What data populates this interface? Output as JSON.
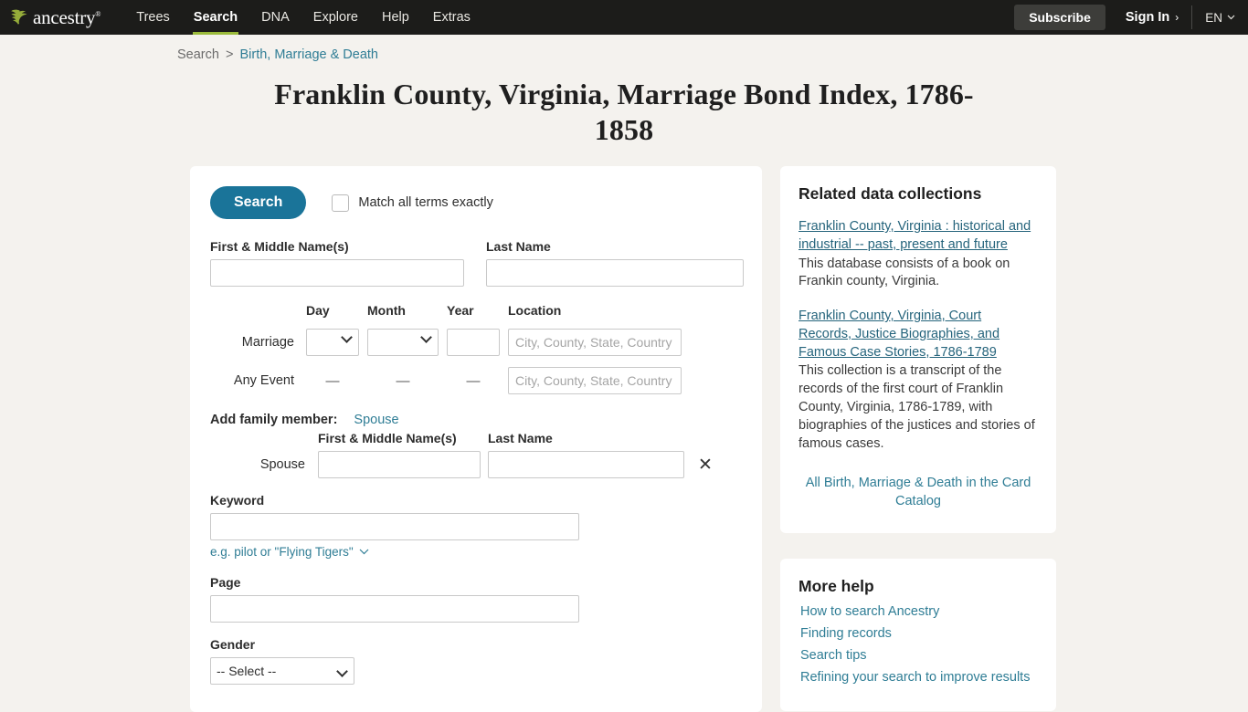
{
  "header": {
    "logo_text": "ancestry",
    "logo_tm": "®",
    "nav": [
      {
        "label": "Trees",
        "active": false
      },
      {
        "label": "Search",
        "active": true
      },
      {
        "label": "DNA",
        "active": false
      },
      {
        "label": "Explore",
        "active": false
      },
      {
        "label": "Help",
        "active": false
      },
      {
        "label": "Extras",
        "active": false
      }
    ],
    "subscribe_label": "Subscribe",
    "signin_label": "Sign In",
    "signin_chevron": "›",
    "language": "EN",
    "language_caret": "⌵"
  },
  "breadcrumb": {
    "root": "Search",
    "separator": ">",
    "current": "Birth, Marriage & Death"
  },
  "page_title": "Franklin County, Virginia, Marriage Bond Index, 1786-1858",
  "form": {
    "search_button": "Search",
    "match_exactly_label": "Match all terms exactly",
    "first_name_label": "First & Middle Name(s)",
    "last_name_label": "Last Name",
    "first_name_value": "",
    "last_name_value": "",
    "event_headers": {
      "day": "Day",
      "month": "Month",
      "year": "Year",
      "location": "Location"
    },
    "marriage_row_label": "Marriage",
    "any_event_row_label": "Any Event",
    "day_value": "",
    "month_value": "",
    "year_value": "",
    "location_placeholder": "City, County, State, Country",
    "marriage_location_value": "",
    "any_event_location_value": "",
    "dash": "—",
    "add_family_label": "Add family member:",
    "add_family_link": "Spouse",
    "spouse_first_label": "First & Middle Name(s)",
    "spouse_last_label": "Last Name",
    "spouse_row_label": "Spouse",
    "spouse_first_value": "",
    "spouse_last_value": "",
    "remove_icon": "✕",
    "keyword_label": "Keyword",
    "keyword_value": "",
    "keyword_hint": "e.g. pilot or \"Flying Tigers\"",
    "keyword_hint_caret": "⌵",
    "page_label": "Page",
    "page_value": "",
    "gender_label": "Gender",
    "gender_value": "-- Select --"
  },
  "sidebar": {
    "related_title": "Related data collections",
    "collections": [
      {
        "link": "Franklin County, Virginia : historical and industrial -- past, present and future",
        "desc": "This database consists of a book on Frankin county, Virginia."
      },
      {
        "link": "Franklin County, Virginia, Court Records, Justice Biographies, and Famous Case Stories, 1786-1789",
        "desc": "This collection is a transcript of the records of the first court of Franklin County, Virginia, 1786-1789, with biographies of the justices and stories of famous cases."
      }
    ],
    "catalog_link": "All Birth, Marriage & Death in the Card Catalog",
    "help_title": "More help",
    "help_links": [
      "How to search Ancestry",
      "Finding records",
      "Search tips",
      "Refining your search to improve results"
    ]
  },
  "colors": {
    "nav_bg": "#1c1c1a",
    "accent_green": "#9bbb3b",
    "primary_teal": "#1a7499",
    "link_teal": "#2f7d95",
    "page_bg": "#f4f2ee"
  }
}
